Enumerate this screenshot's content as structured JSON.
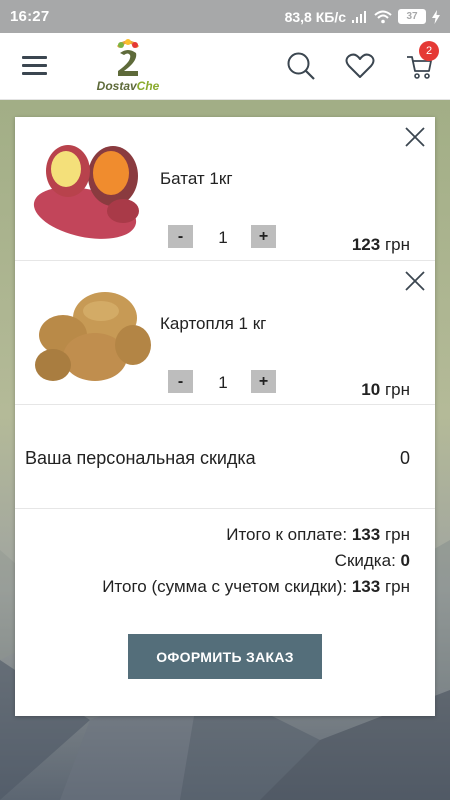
{
  "status_bar": {
    "time": "16:27",
    "speed": "83,8 КБ/с",
    "battery": "37"
  },
  "header": {
    "logo_text_main": "Dostav",
    "logo_text_accent": "Che",
    "cart_count": "2",
    "icons": [
      "menu-icon",
      "search-icon",
      "heart-icon",
      "cart-icon"
    ]
  },
  "cart": {
    "items": [
      {
        "name": "Батат 1кг",
        "qty": "1",
        "price_value": "123",
        "currency": "грн",
        "minus": "-",
        "plus": "+"
      },
      {
        "name": "Картопля 1 кг",
        "qty": "1",
        "price_value": "10",
        "currency": "грн",
        "minus": "-",
        "plus": "+"
      }
    ],
    "discount_label": "Ваша персональная скидка",
    "discount_value": "0",
    "totals": {
      "total_label": "Итого к оплате:",
      "total_value": "133",
      "total_currency": "грн",
      "discount_label": "Скидка:",
      "discount_value": "0",
      "final_label": "Итого (сумма с учетом скидки):",
      "final_value": "133",
      "final_currency": "грн"
    },
    "order_button": "ОФОРМИТЬ ЗАКАЗ"
  },
  "colors": {
    "accent": "#546e7a",
    "badge": "#e53935",
    "status_bar": "#a7a8a9"
  }
}
